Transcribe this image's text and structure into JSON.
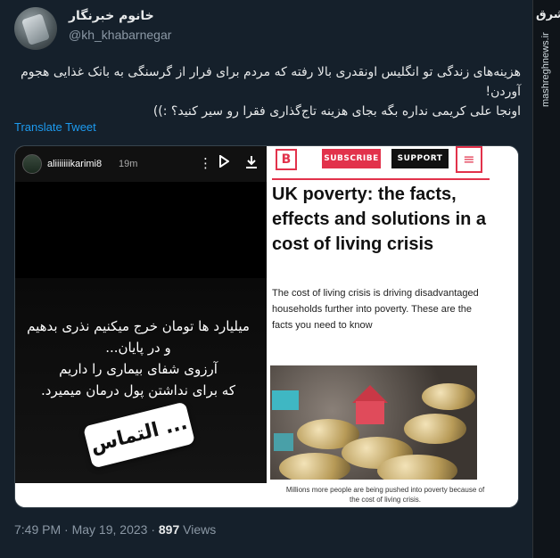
{
  "tweet": {
    "display_name": "خانوم خبرنگار",
    "handle": "@kh_khabarnegar",
    "text_lines": [
      "هزینه‌های زندگی تو انگلیس اونقدری بالا رفته که مردم برای فرار از گرسنگی به بانک غذایی هجوم",
      "آوردن!",
      "اونجا علی کریمی نداره بگه بجای هزینه تاج‌گذاری فقرا رو سیر کنید؟ :))"
    ],
    "translate_label": "Translate Tweet",
    "time": "7:49 PM",
    "date": "May 19, 2023",
    "separator": "·",
    "views_count": "897",
    "views_label": "Views"
  },
  "watermark": {
    "logo": "مشرق",
    "url": "mashreghnews.ir"
  },
  "story": {
    "username": "aliiiiiiikarimi8",
    "time": "19m",
    "icons": [
      "more-icon",
      "play-icon",
      "download-icon"
    ],
    "text_lines": [
      "میلیارد ها تومان خرج میکنیم نذری بدهیم",
      "و در پایان...",
      "آرزوی شفای بیماری را داریم",
      "که برای نداشتن پول درمان میمیرد."
    ],
    "contact_button": "التماس ..."
  },
  "article": {
    "logo_letter": "B",
    "subscribe_label": "SUBSCRIBE",
    "support_label": "SUPPORT",
    "menu_icon": "hamburger-icon",
    "headline": "UK poverty: the facts, effects and solutions in a cost of living crisis",
    "standfirst": "The cost of living crisis is driving disadvantaged households further into poverty. These are the facts you need to know",
    "caption": "Millions more people are being pushed into poverty because of the cost of living crisis.",
    "brand_color": "#e2324b"
  }
}
